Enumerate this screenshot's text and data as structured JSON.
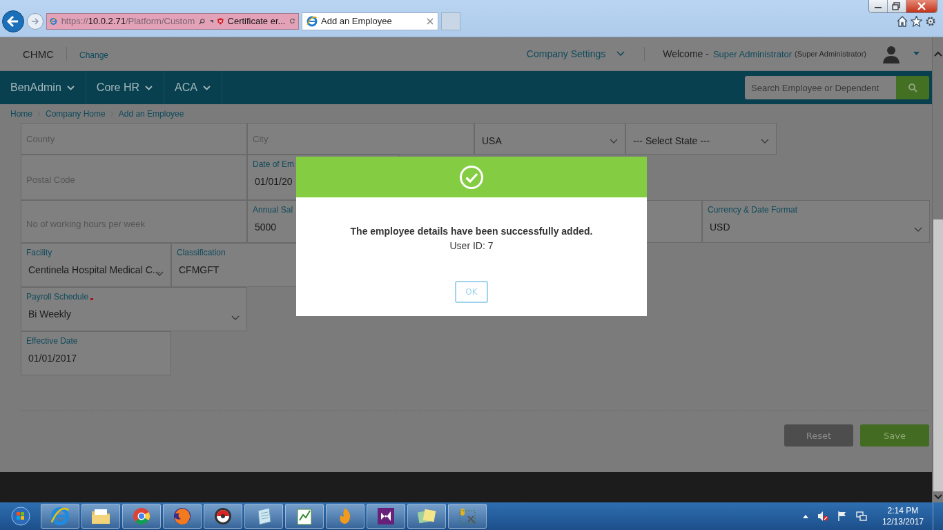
{
  "browser": {
    "url_scheme": "https://",
    "url_host": "10.0.2.71",
    "url_path": "/Platform/Custom",
    "certificate": "Certificate er...",
    "tabs": [
      {
        "label": "Add an Employee",
        "selected": true
      }
    ]
  },
  "header": {
    "company": "CHMC",
    "change_link": "Change",
    "settings_menu": "Company Settings",
    "welcome": "Welcome -",
    "user_name": "Super Administrator",
    "user_role": "(Super Administrator)"
  },
  "nav": [
    {
      "label": "BenAdmin"
    },
    {
      "label": "Core HR"
    },
    {
      "label": "ACA"
    }
  ],
  "search": {
    "placeholder": "Search Employee or Dependent"
  },
  "breadcrumb": [
    "Home",
    "Company Home",
    "Add an Employee"
  ],
  "form_rows": [
    [
      {
        "kind": "text",
        "placeholder": "County"
      },
      {
        "kind": "text",
        "placeholder": "City"
      },
      {
        "kind": "select",
        "value": "USA"
      },
      {
        "kind": "select",
        "value": "--- Select State ---"
      }
    ],
    [
      {
        "kind": "text",
        "placeholder": "Postal Code"
      },
      {
        "kind": "text",
        "label": "Date of Em",
        "value": "01/01/20"
      }
    ],
    [
      {
        "kind": "text",
        "placeholder": "No of working hours per week"
      },
      {
        "kind": "text",
        "label": "Annual Sal",
        "value": "5000"
      },
      {
        "kind": "blank"
      },
      {
        "kind": "select",
        "label": "Currency & Date Format",
        "value": "USD",
        "required": false
      }
    ],
    [
      {
        "kind": "select",
        "label": "Facility",
        "value": "Centinela Hospital Medical C...",
        "required": false
      },
      {
        "kind": "text",
        "label": "Classification",
        "value": "CFMGFT",
        "required": false
      }
    ],
    [
      {
        "kind": "select",
        "label": "Payroll Schedule",
        "value": "Bi Weekly",
        "required": true
      }
    ],
    [
      {
        "kind": "text",
        "label": "Effective Date",
        "value": "01/01/2017",
        "required": false
      }
    ]
  ],
  "buttons": [
    {
      "label": "Reset",
      "kind": "secondary"
    },
    {
      "label": "Save",
      "kind": "primary"
    }
  ],
  "modal": {
    "message": "The employee details have been successfully added.",
    "detail": "User ID: 7",
    "ok": "OK"
  },
  "clock": {
    "time": "2:14 PM",
    "date": "12/13/2017"
  }
}
